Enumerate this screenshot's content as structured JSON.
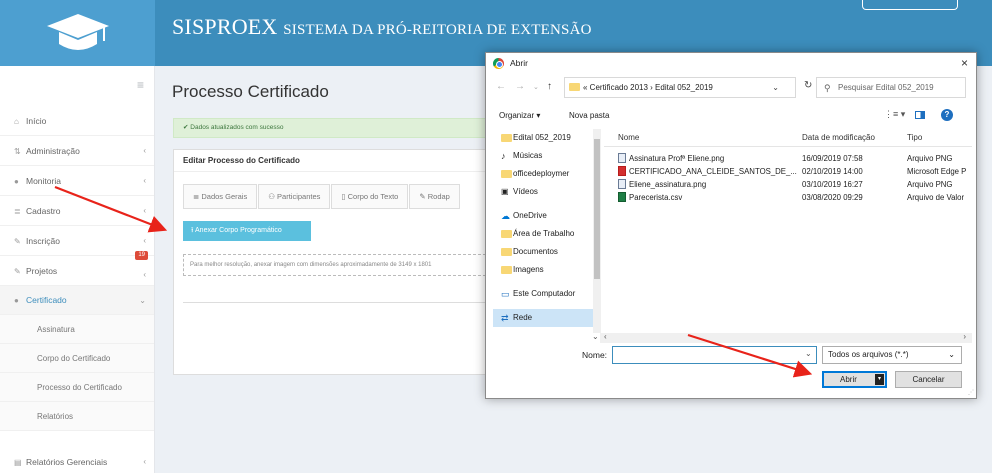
{
  "header": {
    "brand_main": "SISPROEX",
    "brand_sub": "SISTEMA DA PRÓ-REITORIA DE EXTENSÃO"
  },
  "sidebar": {
    "items": [
      {
        "label": "Início",
        "icon": "home-icon"
      },
      {
        "label": "Administração",
        "icon": "sliders-icon"
      },
      {
        "label": "Monitoria",
        "icon": "group-icon"
      },
      {
        "label": "Cadastro",
        "icon": "list-icon"
      },
      {
        "label": "Inscrição",
        "icon": "edit-icon"
      },
      {
        "label": "Projetos",
        "icon": "edit-icon",
        "badge": "19"
      },
      {
        "label": "Certificado",
        "icon": "circle-icon"
      }
    ],
    "subitems": [
      "Assinatura",
      "Corpo do Certificado",
      "Processo do Certificado",
      "Relatórios"
    ],
    "bottom_item": "Relatórios Gerenciais"
  },
  "main": {
    "title": "Processo Certificado",
    "alert": "Dados atualizados com sucesso",
    "panel_title": "Editar Processo do Certificado",
    "tabs": [
      "Dados Gerais",
      "Participantes",
      "Corpo do Texto",
      "Rodap"
    ],
    "attach_button": "Anexar Corpo Programático",
    "hint": "Para melhor resolução, anexar imagem com dimensões aproximadamente de 3149 x 1801"
  },
  "dialog": {
    "title": "Abrir",
    "close": "×",
    "path": "« Certificado 2013 › Edital 052_2019",
    "search_placeholder": "Pesquisar Edital 052_2019",
    "organize": "Organizar ▾",
    "new_folder": "Nova pasta",
    "nav_items": [
      {
        "label": "Edital 052_2019",
        "icon": "folder-icon"
      },
      {
        "label": "Músicas",
        "icon": "music-icon"
      },
      {
        "label": "officedeploymer",
        "icon": "folder-icon"
      },
      {
        "label": "Vídeos",
        "icon": "video-icon"
      },
      {
        "label": "OneDrive",
        "icon": "cloud-icon"
      },
      {
        "label": "Área de Trabalho",
        "icon": "folder-icon"
      },
      {
        "label": "Documentos",
        "icon": "folder-icon"
      },
      {
        "label": "Imagens",
        "icon": "folder-icon"
      },
      {
        "label": "Este Computador",
        "icon": "computer-icon"
      },
      {
        "label": "Rede",
        "icon": "network-icon"
      }
    ],
    "columns": [
      "Nome",
      "Data de modificação",
      "Tipo"
    ],
    "files": [
      {
        "name": "Assinatura Profª Eliene.png",
        "date": "16/09/2019 07:58",
        "type": "Arquivo PNG",
        "kind": "png"
      },
      {
        "name": "CERTIFICADO_ANA_CLEIDE_SANTOS_DE_...",
        "date": "02/10/2019 14:00",
        "type": "Microsoft Edge P",
        "kind": "pdf"
      },
      {
        "name": "Eliene_assinatura.png",
        "date": "03/10/2019 16:27",
        "type": "Arquivo PNG",
        "kind": "png"
      },
      {
        "name": "Parecerista.csv",
        "date": "03/08/2020 09:29",
        "type": "Arquivo de Valor",
        "kind": "csv"
      }
    ],
    "name_label": "Nome:",
    "name_value": "",
    "filter": "Todos os arquivos (*.*)",
    "open_button": "Abrir",
    "cancel_button": "Cancelar"
  },
  "colors": {
    "header_blue": "#3c8dbc",
    "arrow_red": "#e8231a",
    "info_button": "#5bc0de",
    "alert_green": "#dff0d8"
  }
}
